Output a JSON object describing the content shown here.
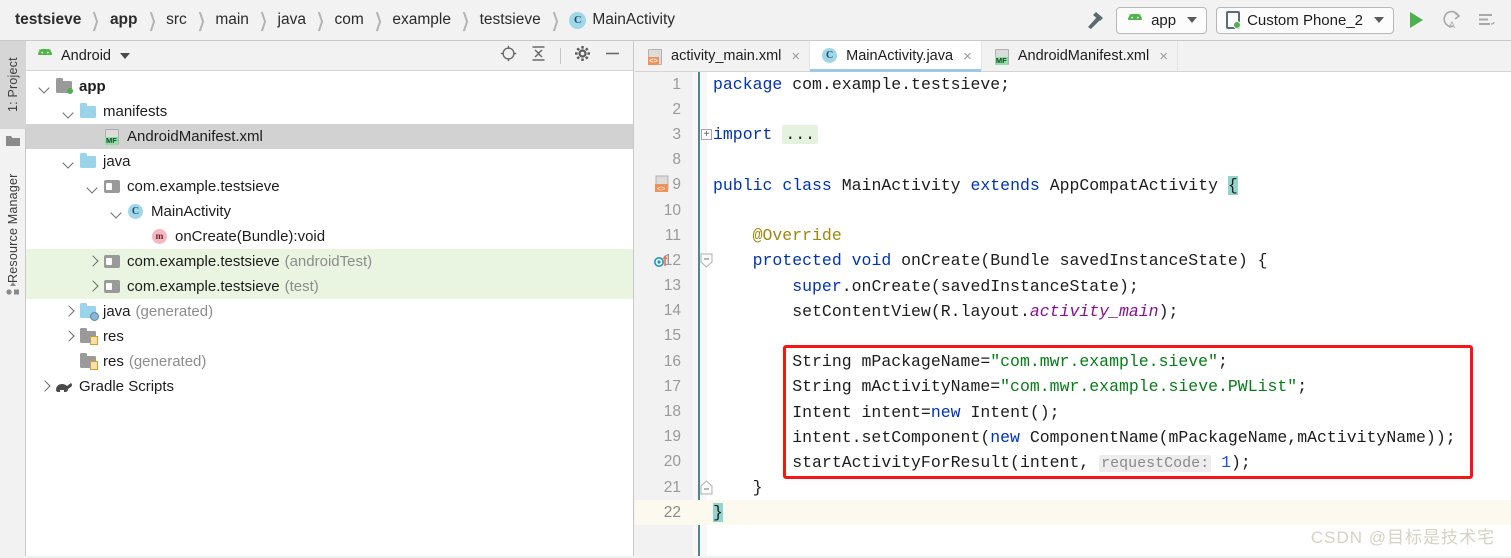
{
  "breadcrumb": {
    "items": [
      {
        "label": "testsieve",
        "bold": true
      },
      {
        "label": "app",
        "bold": true
      },
      {
        "label": "src",
        "bold": false
      },
      {
        "label": "main",
        "bold": false
      },
      {
        "label": "java",
        "bold": false
      },
      {
        "label": "com",
        "bold": false
      },
      {
        "label": "example",
        "bold": false
      },
      {
        "label": "testsieve",
        "bold": false
      }
    ],
    "class_icon_letter": "C",
    "class_name": "MainActivity",
    "separator": "❯"
  },
  "toolbar": {
    "build_hammer": "hammer-icon",
    "module_selector": "app",
    "device_selector": "Custom Phone_2",
    "run_button": "run-icon",
    "apply_changes_button": "apply-changes-icon",
    "apply_code_changes_button": "apply-code-changes-icon"
  },
  "left_strip": {
    "project_tab": "1: Project",
    "resource_manager_tab": "Resource Manager"
  },
  "project_panel": {
    "title": "Android",
    "tools": [
      "select-opened-file-icon",
      "collapse-all-icon",
      "settings-gear-icon",
      "hide-icon"
    ],
    "tree": [
      {
        "label": "app",
        "sub": "",
        "indent": 0,
        "twisty": "down",
        "icon": "module-folder",
        "bold": true,
        "state": "normal"
      },
      {
        "label": "manifests",
        "sub": "",
        "indent": 1,
        "twisty": "down",
        "icon": "folder-blue",
        "bold": false,
        "state": "normal"
      },
      {
        "label": "AndroidManifest.xml",
        "sub": "",
        "indent": 2,
        "twisty": "none",
        "icon": "manifest-file",
        "bold": false,
        "state": "selected"
      },
      {
        "label": "java",
        "sub": "",
        "indent": 1,
        "twisty": "down",
        "icon": "folder-blue",
        "bold": false,
        "state": "normal"
      },
      {
        "label": "com.example.testsieve",
        "sub": "",
        "indent": 2,
        "twisty": "down",
        "icon": "package",
        "bold": false,
        "state": "normal"
      },
      {
        "label": "MainActivity",
        "sub": "",
        "indent": 3,
        "twisty": "down",
        "icon": "class-c",
        "bold": false,
        "state": "normal"
      },
      {
        "label": "onCreate(Bundle):void",
        "sub": "",
        "indent": 4,
        "twisty": "none",
        "icon": "method-m",
        "bold": false,
        "state": "normal"
      },
      {
        "label": "com.example.testsieve",
        "sub": "(androidTest)",
        "indent": 2,
        "twisty": "right",
        "icon": "package",
        "bold": false,
        "state": "testsrc"
      },
      {
        "label": "com.example.testsieve",
        "sub": "(test)",
        "indent": 2,
        "twisty": "right",
        "icon": "package",
        "bold": false,
        "state": "testsrc"
      },
      {
        "label": "java",
        "sub": "(generated)",
        "indent": 1,
        "twisty": "right",
        "icon": "folder-generated",
        "bold": false,
        "state": "normal"
      },
      {
        "label": "res",
        "sub": "",
        "indent": 1,
        "twisty": "right",
        "icon": "folder-res",
        "bold": false,
        "state": "normal"
      },
      {
        "label": "res",
        "sub": "(generated)",
        "indent": 1,
        "twisty": "none",
        "icon": "folder-res",
        "bold": false,
        "state": "normal"
      },
      {
        "label": "Gradle Scripts",
        "sub": "",
        "indent": 0,
        "twisty": "right",
        "icon": "gradle-elephant",
        "bold": false,
        "state": "normal"
      }
    ]
  },
  "editor": {
    "tabs": [
      {
        "label": "activity_main.xml",
        "icon": "layout-xml-icon",
        "active": false,
        "closable": true
      },
      {
        "label": "MainActivity.java",
        "icon": "java-class-icon",
        "active": true,
        "closable": true
      },
      {
        "label": "AndroidManifest.xml",
        "icon": "manifest-xml-icon",
        "active": false,
        "closable": true
      }
    ],
    "lines": [
      {
        "num": "1",
        "gutter": "",
        "fold": "",
        "current": false,
        "tokens": [
          {
            "t": "package ",
            "c": "kw"
          },
          {
            "t": "com.example.testsieve;",
            "c": ""
          }
        ]
      },
      {
        "num": "2",
        "gutter": "",
        "fold": "",
        "current": false,
        "tokens": []
      },
      {
        "num": "3",
        "gutter": "",
        "fold": "plus",
        "current": false,
        "tokens": [
          {
            "t": "import ",
            "c": "kw"
          },
          {
            "t": "...",
            "c": "fold-ph"
          }
        ]
      },
      {
        "num": "8",
        "gutter": "",
        "fold": "",
        "current": false,
        "tokens": []
      },
      {
        "num": "9",
        "gutter": "layout-marker",
        "fold": "",
        "current": false,
        "tokens": [
          {
            "t": "public ",
            "c": "kw"
          },
          {
            "t": "class ",
            "c": "kw"
          },
          {
            "t": "MainActivity ",
            "c": ""
          },
          {
            "t": "extends ",
            "c": "kw"
          },
          {
            "t": "AppCompatActivity ",
            "c": ""
          },
          {
            "t": "{",
            "c": "brace-hl"
          }
        ]
      },
      {
        "num": "10",
        "gutter": "",
        "fold": "",
        "current": false,
        "tokens": []
      },
      {
        "num": "11",
        "gutter": "",
        "fold": "",
        "current": false,
        "tokens": [
          {
            "t": "    @Override",
            "c": "ann"
          }
        ]
      },
      {
        "num": "12",
        "gutter": "override-marker",
        "fold": "shield",
        "current": false,
        "tokens": [
          {
            "t": "    ",
            "c": ""
          },
          {
            "t": "protected ",
            "c": "kw"
          },
          {
            "t": "void ",
            "c": "kw"
          },
          {
            "t": "onCreate",
            "c": "mth"
          },
          {
            "t": "(Bundle savedInstanceState) {",
            "c": ""
          }
        ]
      },
      {
        "num": "13",
        "gutter": "",
        "fold": "",
        "current": false,
        "tokens": [
          {
            "t": "        ",
            "c": ""
          },
          {
            "t": "super",
            "c": "kw"
          },
          {
            "t": ".onCreate(savedInstanceState);",
            "c": ""
          }
        ]
      },
      {
        "num": "14",
        "gutter": "",
        "fold": "",
        "current": false,
        "tokens": [
          {
            "t": "        setContentView(R.layout.",
            "c": ""
          },
          {
            "t": "activity_main",
            "c": "fld"
          },
          {
            "t": ");",
            "c": ""
          }
        ]
      },
      {
        "num": "15",
        "gutter": "",
        "fold": "",
        "current": false,
        "tokens": []
      },
      {
        "num": "16",
        "gutter": "",
        "fold": "",
        "current": false,
        "tokens": [
          {
            "t": "        String mPackageName=",
            "c": ""
          },
          {
            "t": "\"com.mwr.example.sieve\"",
            "c": "str"
          },
          {
            "t": ";",
            "c": ""
          }
        ]
      },
      {
        "num": "17",
        "gutter": "",
        "fold": "",
        "current": false,
        "tokens": [
          {
            "t": "        String mActivityName=",
            "c": ""
          },
          {
            "t": "\"com.mwr.example.sieve.PWList\"",
            "c": "str"
          },
          {
            "t": ";",
            "c": ""
          }
        ]
      },
      {
        "num": "18",
        "gutter": "",
        "fold": "",
        "current": false,
        "tokens": [
          {
            "t": "        Intent intent=",
            "c": ""
          },
          {
            "t": "new",
            "c": "kw"
          },
          {
            "t": " Intent();",
            "c": ""
          }
        ]
      },
      {
        "num": "19",
        "gutter": "",
        "fold": "",
        "current": false,
        "tokens": [
          {
            "t": "        intent.setComponent(",
            "c": ""
          },
          {
            "t": "new",
            "c": "kw"
          },
          {
            "t": " ComponentName(mPackageName,mActivityName));",
            "c": ""
          }
        ]
      },
      {
        "num": "20",
        "gutter": "",
        "fold": "",
        "current": false,
        "tokens": [
          {
            "t": "        startActivityForResult(intent, ",
            "c": ""
          },
          {
            "t": "requestCode:",
            "c": "hint"
          },
          {
            "t": " ",
            "c": ""
          },
          {
            "t": "1",
            "c": "num2"
          },
          {
            "t": ");",
            "c": ""
          }
        ]
      },
      {
        "num": "21",
        "gutter": "",
        "fold": "shield-end",
        "current": false,
        "tokens": [
          {
            "t": "    }",
            "c": ""
          }
        ]
      },
      {
        "num": "22",
        "gutter": "",
        "fold": "",
        "current": true,
        "tokens": [
          {
            "t": "}",
            "c": "brace-hl"
          }
        ]
      }
    ],
    "annotation_box_color": "#f61616",
    "watermark": "CSDN @目标是技术宅"
  }
}
